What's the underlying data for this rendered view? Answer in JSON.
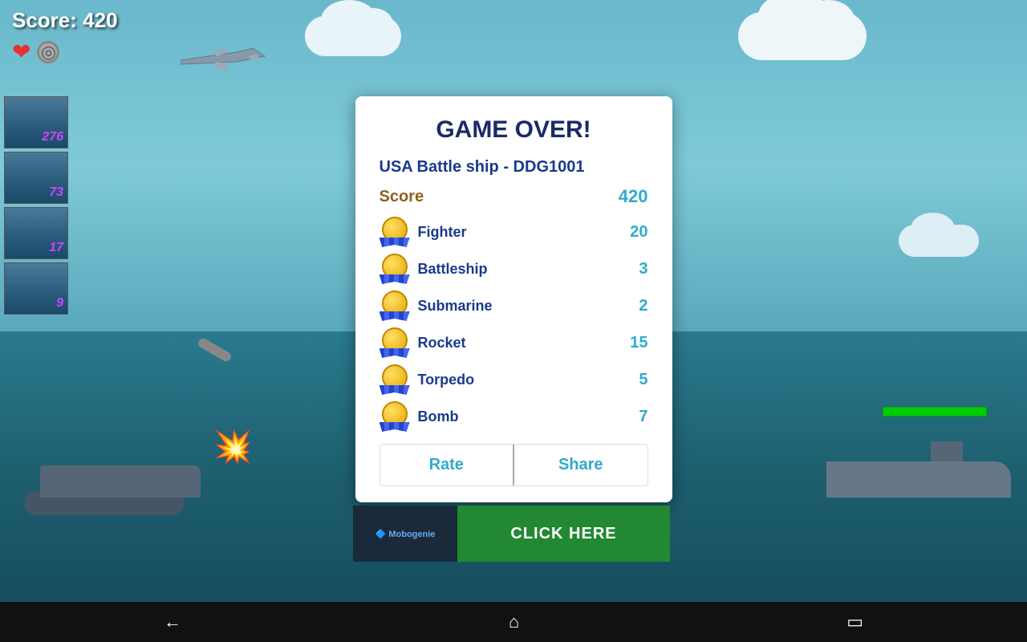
{
  "game": {
    "score_label": "Score: 420",
    "score_value": "420"
  },
  "modal": {
    "title": "GAME OVER!",
    "ship_name": "USA Battle ship - DDG1001",
    "score_label": "Score",
    "score_value": "420",
    "stats": [
      {
        "name": "Fighter",
        "value": "20"
      },
      {
        "name": "Battleship",
        "value": "3"
      },
      {
        "name": "Submarine",
        "value": "2"
      },
      {
        "name": "Rocket",
        "value": "15"
      },
      {
        "name": "Torpedo",
        "value": "5"
      },
      {
        "name": "Bomb",
        "value": "7"
      }
    ],
    "btn_rate": "Rate",
    "btn_share": "Share"
  },
  "side_thumbnails": [
    {
      "score": "276"
    },
    {
      "score": "73"
    },
    {
      "score": "17"
    },
    {
      "score": "9"
    }
  ],
  "ad": {
    "logo": "Mobogenie",
    "cta": "CLICK HERE"
  },
  "nav": {
    "back": "←",
    "home": "⌂",
    "recents": "▭"
  }
}
